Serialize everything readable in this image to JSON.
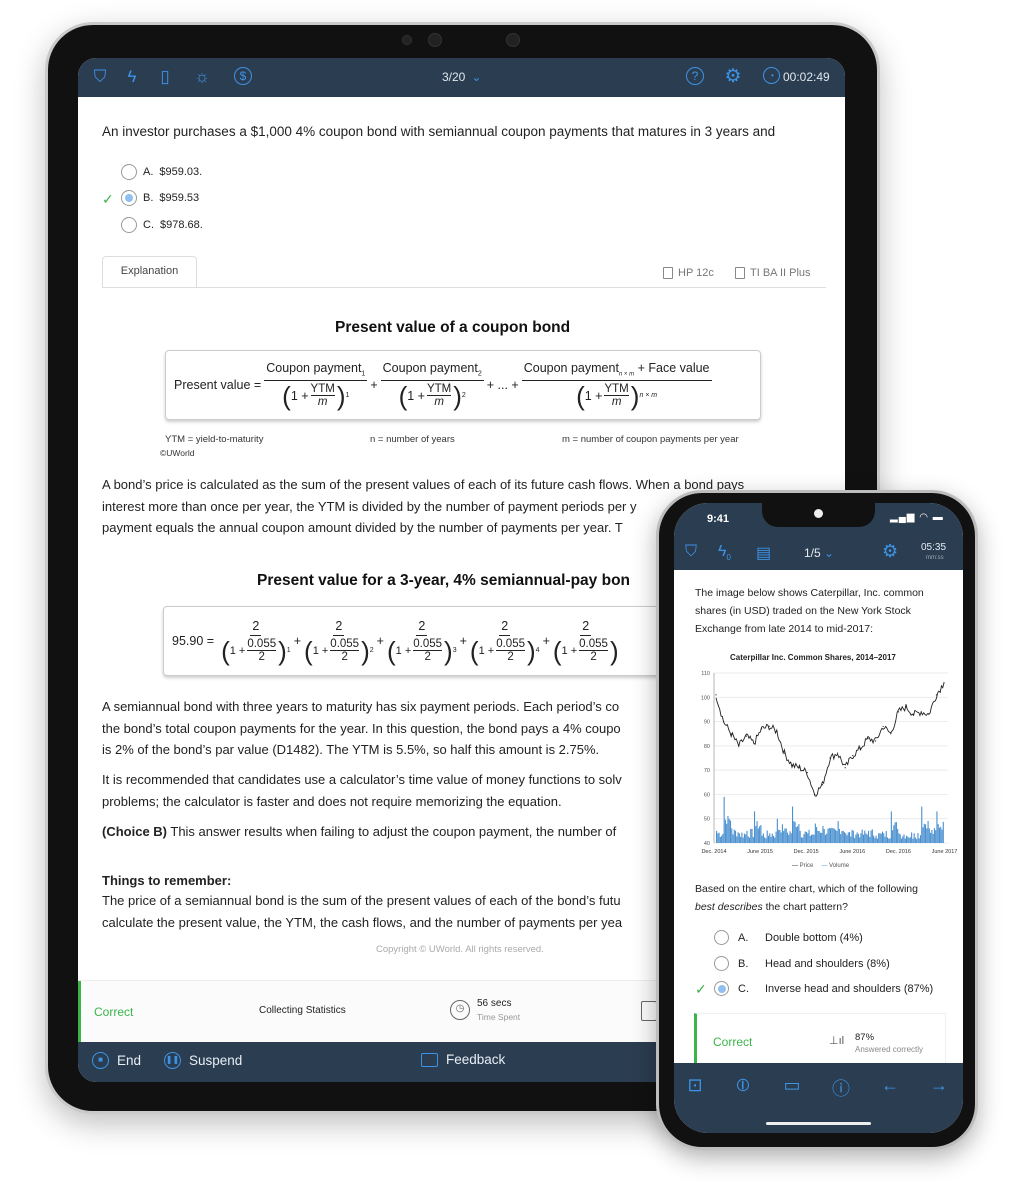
{
  "tablet": {
    "header": {
      "progress": "3/20",
      "timer": "00:02:49",
      "icons": [
        "bookmark-icon",
        "flash-icon",
        "note-icon",
        "lightbulb-icon",
        "dollar-icon",
        "help-icon",
        "gear-icon",
        "clock-icon"
      ]
    },
    "question": "An investor purchases a $1,000 4% coupon bond with semiannual coupon payments that matures in 3 years and",
    "options": [
      {
        "letter": "A.",
        "text": "$959.03."
      },
      {
        "letter": "B.",
        "text": "$959.53",
        "selected": true,
        "correct": true
      },
      {
        "letter": "C.",
        "text": "$978.68."
      }
    ],
    "tabs": {
      "explanation": "Explanation",
      "hp": "HP 12c",
      "ti": "TI BA II Plus"
    },
    "figure1": {
      "title": "Present value of a coupon bond",
      "lhs": "Present value =",
      "num1": "Coupon payment",
      "sub1": "1",
      "num2": "Coupon payment",
      "sub2": "2",
      "num3": "Coupon payment",
      "sub3": "n × m",
      "face": "+ Face value",
      "one": "1 +",
      "ytm": "YTM",
      "m": "m",
      "exp1": "1",
      "exp2": "2",
      "exp3": "n × m",
      "dots": "+ ... +",
      "plus": "+",
      "legend_ytm": "YTM = yield-to-maturity",
      "legend_n": "n = number of years",
      "legend_m": "m = number of coupon payments per year",
      "copyright": "©UWorld"
    },
    "para1": [
      "A bond’s price is calculated as the sum of the present values of each of its future cash flows.  When a bond pays",
      "interest more than once per year, the YTM is divided by the number of payment periods per y",
      "payment equals the annual coupon amount divided by the number of payments per year.  T"
    ],
    "figure2": {
      "title": "Present value for a 3-year, 4% semiannual-pay bon",
      "lhs": "95.90 =",
      "numerator": "2",
      "rate": "0.055",
      "div": "2",
      "one": "1 +",
      "exps": [
        "1",
        "2",
        "3",
        "4",
        ""
      ]
    },
    "para2": [
      "A semiannual bond with three years to maturity has six payment periods.  Each period’s co",
      "the bond’s total coupon payments for the year.  In this question, the bond pays a 4% coupo",
      "is 2% of the bond’s par value (D1482).  The YTM is 5.5%, so half this amount is 2.75%."
    ],
    "para3": [
      "It is recommended that candidates use a calculator’s time value of money functions to solv",
      "problems; the calculator is faster and does not require memorizing the equation."
    ],
    "choiceB": {
      "label": "(Choice B)",
      "text": " This answer results when failing to adjust the coupon payment, the number of"
    },
    "remember": {
      "title": "Things to remember:",
      "lines": [
        "The price of a semiannual bond is the sum of the present values of each of the bond’s futu",
        "calculate the present value, the YTM, the cash flows, and the number of payments per yea"
      ]
    },
    "copyright": "Copyright © UWorld. All rights reserved.",
    "footer": {
      "status": "Correct",
      "stats": "Collecting Statistics",
      "time": "56 secs",
      "time_label": "Time Spent"
    },
    "bottom": {
      "end": "End",
      "suspend": "Suspend",
      "feedback": "Feedback"
    },
    "colors": {
      "header": "#2b3d51",
      "accent": "#3d93e6",
      "correct": "#3bb54a"
    }
  },
  "phone": {
    "status": {
      "time": "9:41"
    },
    "header": {
      "flash_count": "0",
      "progress": "1/5",
      "timer": "05:35",
      "timer_unit": "mm:ss"
    },
    "intro": [
      "The image below shows Caterpillar, Inc. common",
      "shares (in USD) traded on the New York Stock",
      "Exchange from late 2014 to mid-2017:"
    ],
    "question_pre": "Based on the entire chart, which of the following",
    "question_em": "best describes",
    "question_post": " the chart pattern?",
    "options": [
      {
        "letter": "A.",
        "text": "Double bottom (4%)"
      },
      {
        "letter": "B.",
        "text": "Head and shoulders (8%)"
      },
      {
        "letter": "C.",
        "text": "Inverse head and shoulders (87%)",
        "selected": true,
        "correct": true
      }
    ],
    "result": {
      "status": "Correct",
      "percent": "87%",
      "label": "Answered correctly"
    },
    "bottom_icons": [
      "stop-icon",
      "pause-icon",
      "feedback-icon",
      "info-icon",
      "arrow-left-icon",
      "arrow-right-icon"
    ]
  },
  "chart_data": {
    "type": "line",
    "title": "Caterpillar Inc. Common Shares, 2014–2017",
    "x_ticks": [
      "Dec. 2014",
      "June 2015",
      "Dec. 2015",
      "June 2016",
      "Dec. 2016",
      "June 2017"
    ],
    "y_ticks": [
      "40",
      "50",
      "60",
      "70",
      "80",
      "90",
      "100",
      "110"
    ],
    "ylim": [
      40,
      110
    ],
    "grid": true,
    "legend": {
      "placement": "bottom",
      "entries": [
        "Price",
        "Volume"
      ]
    },
    "series": [
      {
        "name": "Price",
        "x": [
          "2014-12",
          "2015-01",
          "2015-02",
          "2015-03",
          "2015-04",
          "2015-05",
          "2015-06",
          "2015-07",
          "2015-08",
          "2015-09",
          "2015-10",
          "2015-11",
          "2015-12",
          "2016-01",
          "2016-02",
          "2016-03",
          "2016-04",
          "2016-05",
          "2016-06",
          "2016-07",
          "2016-08",
          "2016-09",
          "2016-10",
          "2016-11",
          "2016-12",
          "2017-01",
          "2017-02",
          "2017-03",
          "2017-04",
          "2017-05",
          "2017-06"
        ],
        "values": [
          101,
          90,
          85,
          80,
          84,
          81,
          87,
          88,
          86,
          77,
          72,
          71,
          69,
          60,
          64,
          75,
          77,
          71,
          76,
          79,
          83,
          82,
          88,
          85,
          94,
          96,
          93,
          94,
          93,
          101,
          106
        ]
      },
      {
        "name": "Volume",
        "x": [
          "2014-12",
          "2015-01",
          "2015-02",
          "2015-03",
          "2015-04",
          "2015-05",
          "2015-06",
          "2015-07",
          "2015-08",
          "2015-09",
          "2015-10",
          "2015-11",
          "2015-12",
          "2016-01",
          "2016-02",
          "2016-03",
          "2016-04",
          "2016-05",
          "2016-06",
          "2016-07",
          "2016-08",
          "2016-09",
          "2016-10",
          "2016-11",
          "2016-12",
          "2017-01",
          "2017-02",
          "2017-03",
          "2017-04",
          "2017-05",
          "2017-06"
        ],
        "values": [
          45,
          59,
          46,
          44,
          45,
          53,
          43,
          44,
          50,
          46,
          55,
          45,
          44,
          48,
          47,
          46,
          49,
          44,
          45,
          44,
          45,
          43,
          44,
          53,
          44,
          43,
          44,
          55,
          46,
          53,
          48
        ]
      }
    ],
    "colors": {
      "Price": "#222222",
      "Volume": "#4a90d0"
    }
  }
}
